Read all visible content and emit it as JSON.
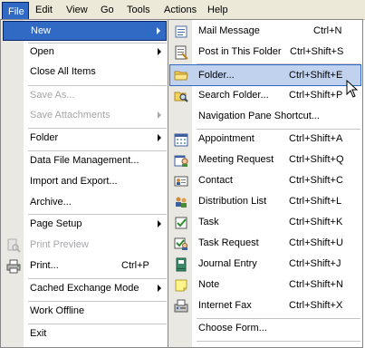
{
  "menubar": {
    "items": [
      {
        "label": "File"
      },
      {
        "label": "Edit"
      },
      {
        "label": "View"
      },
      {
        "label": "Go"
      },
      {
        "label": "Tools"
      },
      {
        "label": "Actions"
      },
      {
        "label": "Help"
      }
    ]
  },
  "file_menu": {
    "items": [
      {
        "label": "New"
      },
      {
        "label": "Open"
      },
      {
        "label": "Close All Items"
      },
      {
        "label": "Save As..."
      },
      {
        "label": "Save Attachments"
      },
      {
        "label": "Folder"
      },
      {
        "label": "Data File Management..."
      },
      {
        "label": "Import and Export..."
      },
      {
        "label": "Archive..."
      },
      {
        "label": "Page Setup"
      },
      {
        "label": "Print Preview"
      },
      {
        "label": "Print...",
        "shortcut": "Ctrl+P"
      },
      {
        "label": "Cached Exchange Mode"
      },
      {
        "label": "Work Offline"
      },
      {
        "label": "Exit"
      }
    ]
  },
  "new_menu": {
    "items": [
      {
        "label": "Mail Message",
        "shortcut": "Ctrl+N"
      },
      {
        "label": "Post in This Folder",
        "shortcut": "Ctrl+Shift+S"
      },
      {
        "label": "Folder...",
        "shortcut": "Ctrl+Shift+E"
      },
      {
        "label": "Search Folder...",
        "shortcut": "Ctrl+Shift+P"
      },
      {
        "label": "Navigation Pane Shortcut..."
      },
      {
        "label": "Appointment",
        "shortcut": "Ctrl+Shift+A"
      },
      {
        "label": "Meeting Request",
        "shortcut": "Ctrl+Shift+Q"
      },
      {
        "label": "Contact",
        "shortcut": "Ctrl+Shift+C"
      },
      {
        "label": "Distribution List",
        "shortcut": "Ctrl+Shift+L"
      },
      {
        "label": "Task",
        "shortcut": "Ctrl+Shift+K"
      },
      {
        "label": "Task Request",
        "shortcut": "Ctrl+Shift+U"
      },
      {
        "label": "Journal Entry",
        "shortcut": "Ctrl+Shift+J"
      },
      {
        "label": "Note",
        "shortcut": "Ctrl+Shift+N"
      },
      {
        "label": "Internet Fax",
        "shortcut": "Ctrl+Shift+X"
      },
      {
        "label": "Choose Form..."
      }
    ]
  },
  "colors": {
    "menubar_bg": "#ece9d8",
    "highlight_dark": "#316ac5",
    "highlight_light": "#c1d2ee",
    "gutter": "#e9e8e3",
    "disabled_text": "#a7a6aa"
  }
}
